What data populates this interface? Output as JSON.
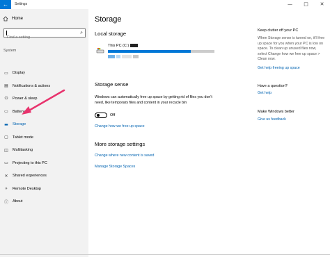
{
  "window": {
    "title": "Settings",
    "back_icon": "←",
    "minimize_icon": "—",
    "maximize_icon": "□",
    "close_icon": "✕"
  },
  "sidebar": {
    "home_label": "Home",
    "search_placeholder": "Find a setting",
    "section_label": "System",
    "items": [
      {
        "label": "Display",
        "icon": "display-icon",
        "glyph": "▭",
        "active": false
      },
      {
        "label": "Notifications & actions",
        "icon": "notifications-icon",
        "glyph": "▤",
        "active": false
      },
      {
        "label": "Power & sleep",
        "icon": "power-icon",
        "glyph": "⏻",
        "active": false
      },
      {
        "label": "Battery",
        "icon": "battery-icon",
        "glyph": "▭",
        "active": false
      },
      {
        "label": "Storage",
        "icon": "storage-icon",
        "glyph": "▬",
        "active": true
      },
      {
        "label": "Tablet mode",
        "icon": "tablet-mode-icon",
        "glyph": "▢",
        "active": false
      },
      {
        "label": "Multitasking",
        "icon": "multitasking-icon",
        "glyph": "◫",
        "active": false
      },
      {
        "label": "Projecting to this PC",
        "icon": "projecting-icon",
        "glyph": "▭",
        "active": false
      },
      {
        "label": "Shared experiences",
        "icon": "shared-experiences-icon",
        "glyph": "✕",
        "active": false
      },
      {
        "label": "Remote Desktop",
        "icon": "remote-desktop-icon",
        "glyph": "»",
        "active": false
      },
      {
        "label": "About",
        "icon": "about-icon",
        "glyph": "ⓘ",
        "active": false
      }
    ]
  },
  "main": {
    "title": "Storage",
    "local_storage_heading": "Local storage",
    "drive": {
      "label": "This PC (C:)",
      "used_fraction": 0.78,
      "blurred_fraction": 0.2
    },
    "storage_sense_heading": "Storage sense",
    "storage_sense_text": "Windows can automatically free up space by getting rid of files you don't need, like temporary files and content in your recycle bin",
    "toggle_state": "Off",
    "change_free_space_link": "Change how we free up space",
    "more_settings_heading": "More storage settings",
    "new_content_link": "Change where new content is saved",
    "manage_spaces_link": "Manage Storage Spaces"
  },
  "right_pane": {
    "clutter_heading": "Keep clutter off your PC",
    "clutter_text": "When Storage sense is turned on, it'll free up space for you when your PC is low on space. To clean up unused files now, select Change how we free up space > Clean now.",
    "clutter_link": "Get help freeing up space",
    "question_heading": "Have a question?",
    "question_link": "Get help",
    "better_heading": "Make Windows better",
    "better_link": "Give us feedback"
  },
  "colors": {
    "accent": "#0078d7",
    "link": "#0063b1",
    "annotation_arrow": "#e8336d",
    "sidebar_bg": "#f2f2f2"
  }
}
